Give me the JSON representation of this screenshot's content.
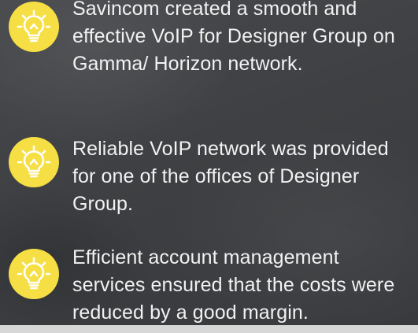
{
  "items": [
    {
      "icon": "lightbulb-icon",
      "text": "Savincom created a smooth and effective VoIP for Designer Group on Gamma/ Horizon network."
    },
    {
      "icon": "lightbulb-icon",
      "text": "Reliable VoIP network was provided for one of the offices of Designer Group."
    },
    {
      "icon": "lightbulb-icon",
      "text": "Efficient account management services ensured that the costs were reduced by a good margin."
    }
  ],
  "colors": {
    "icon_circle": "#f6de45",
    "icon_glyph": "#ffffff",
    "text": "#f2f2f2",
    "background": "#3f4144"
  }
}
